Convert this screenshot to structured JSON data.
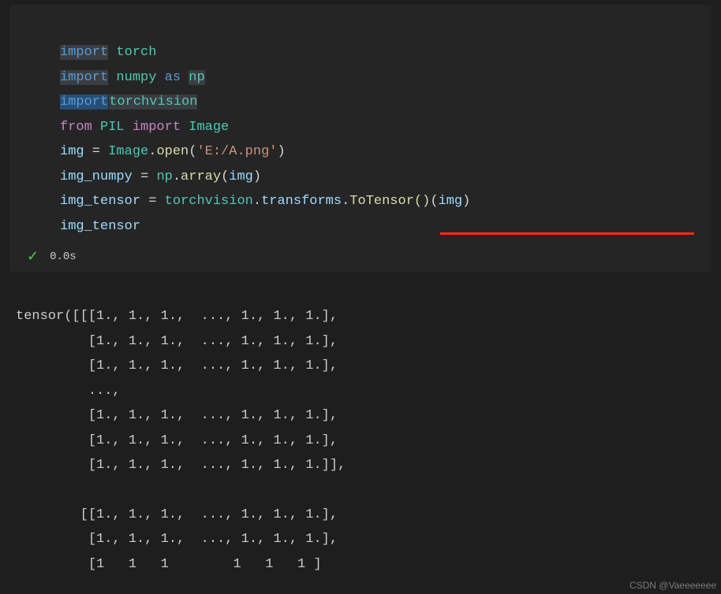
{
  "code": {
    "line1": {
      "import": "import",
      "torch": "torch"
    },
    "line2": {
      "import": "import",
      "numpy": "numpy",
      "as": "as",
      "np": "np"
    },
    "line3": {
      "import": "import",
      "torchvision": "torchvision"
    },
    "line4": {
      "from": "from",
      "PIL": "PIL",
      "import": "import",
      "Image": "Image"
    },
    "line5": {
      "img": "img",
      "eq": " = ",
      "Image": "Image",
      "dot": ".",
      "open": "open",
      "lp": "(",
      "str": "'E:/A.png'",
      "rp": ")"
    },
    "line6": {
      "img_numpy": "img_numpy",
      "eq": " = ",
      "np": "np",
      "dot": ".",
      "array": "array",
      "lp": "(",
      "img": "img",
      "rp": ")"
    },
    "line7": {
      "img_tensor": "img_tensor",
      "eq": " = ",
      "torchvision": "torchvision",
      "dot1": ".",
      "transforms": "transforms",
      "dot2": ".",
      "ToTensor": "ToTensor",
      "lp1": "(",
      "rp1": ")",
      "lp2": "(",
      "img": "img",
      "rp2": ")"
    },
    "line8": {
      "img_tensor": "img_tensor"
    }
  },
  "status": {
    "check": "✓",
    "timing": "0.0s"
  },
  "output": {
    "l1": "tensor([[[1., 1., 1.,  ..., 1., 1., 1.],",
    "l2": "         [1., 1., 1.,  ..., 1., 1., 1.],",
    "l3": "         [1., 1., 1.,  ..., 1., 1., 1.],",
    "l4": "         ...,",
    "l5": "         [1., 1., 1.,  ..., 1., 1., 1.],",
    "l6": "         [1., 1., 1.,  ..., 1., 1., 1.],",
    "l7": "         [1., 1., 1.,  ..., 1., 1., 1.]],",
    "l8": "",
    "l9": "        [[1., 1., 1.,  ..., 1., 1., 1.],",
    "l10": "         [1., 1., 1.,  ..., 1., 1., 1.],",
    "l11": "         [1   1   1        1   1   1 ]"
  },
  "watermark": "CSDN @Vaeeeeeee"
}
